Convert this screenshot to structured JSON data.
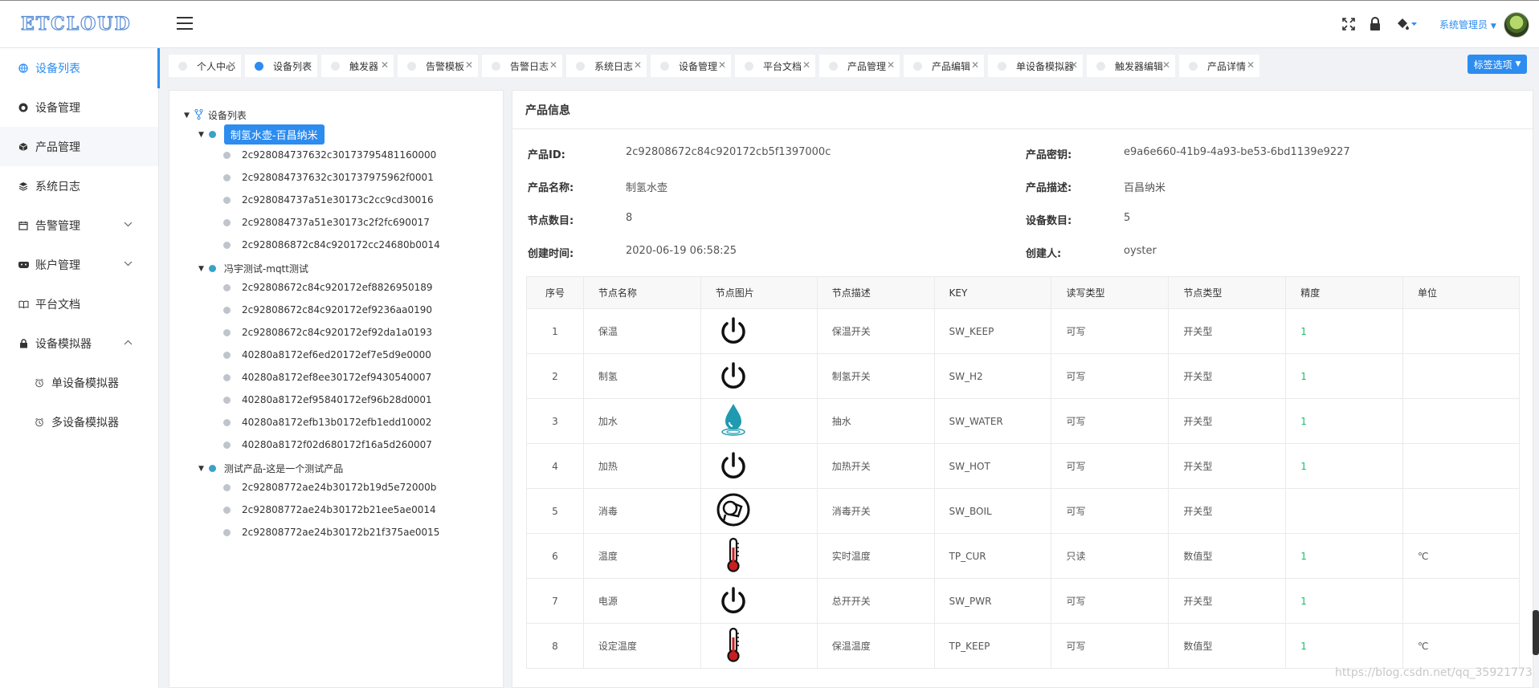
{
  "header": {
    "logo": "ETCLOUD",
    "user_label": "系统管理员",
    "icons": [
      "fullscreen-icon",
      "lock-icon",
      "paint-bucket-icon"
    ]
  },
  "sidebar": {
    "items": [
      {
        "label": "设备列表",
        "icon": "globe-icon",
        "active": true
      },
      {
        "label": "设备管理",
        "icon": "github-icon"
      },
      {
        "label": "产品管理",
        "icon": "cube-icon"
      },
      {
        "label": "系统日志",
        "icon": "layers-icon"
      },
      {
        "label": "告警管理",
        "icon": "calendar-icon",
        "expandable": true
      },
      {
        "label": "账户管理",
        "icon": "gamepad-icon",
        "expandable": true
      },
      {
        "label": "平台文档",
        "icon": "book-icon"
      },
      {
        "label": "设备模拟器",
        "icon": "lock-icon",
        "expandable": true,
        "expanded": true
      }
    ],
    "subitems": [
      {
        "label": "单设备模拟器",
        "icon": "alarm-clock-icon"
      },
      {
        "label": "多设备模拟器",
        "icon": "alarm-clock-icon"
      }
    ]
  },
  "tabs": [
    {
      "label": "个人中心"
    },
    {
      "label": "设备列表",
      "active": true
    },
    {
      "label": "触发器"
    },
    {
      "label": "告警模板"
    },
    {
      "label": "告警日志"
    },
    {
      "label": "系统日志"
    },
    {
      "label": "设备管理"
    },
    {
      "label": "平台文档"
    },
    {
      "label": "产品管理"
    },
    {
      "label": "产品编辑"
    },
    {
      "label": "单设备模拟器"
    },
    {
      "label": "触发器编辑"
    },
    {
      "label": "产品详情"
    }
  ],
  "tab_options_label": "标签选项",
  "tree": {
    "root": "设备列表",
    "groups": [
      {
        "label": "制氢水壶-百昌纳米",
        "selected": true,
        "devices": [
          "2c928084737632c30173795481160000",
          "2c928084737632c301737975962f0001",
          "2c928084737a51e30173c2cc9cd30016",
          "2c928084737a51e30173c2f2fc690017",
          "2c928086872c84c920172cc24680b0014"
        ]
      },
      {
        "label": "冯宇测试-mqtt测试",
        "devices": [
          "2c92808672c84c920172ef8826950189",
          "2c92808672c84c920172ef9236aa0190",
          "2c92808672c84c920172ef92da1a0193",
          "40280a8172ef6ed20172ef7e5d9e0000",
          "40280a8172ef8ee30172ef9430540007",
          "40280a8172ef95840172ef96b28d0001",
          "40280a8172efb13b0172efb1edd10002",
          "40280a8172f02d680172f16a5d260007"
        ]
      },
      {
        "label": "测试产品-这是一个测试产品",
        "devices": [
          "2c92808772ae24b30172b19d5e72000b",
          "2c92808772ae24b30172b21ee5ae0014",
          "2c92808772ae24b30172b21f375ae0015"
        ]
      }
    ]
  },
  "product": {
    "title": "产品信息",
    "fields": {
      "id_label": "产品ID:",
      "id_value": "2c92808672c84c920172cb5f1397000c",
      "secret_label": "产品密钥:",
      "secret_value": "e9a6e660-41b9-4a93-be53-6bd1139e9227",
      "name_label": "产品名称:",
      "name_value": "制氢水壶",
      "desc_label": "产品描述:",
      "desc_value": "百昌纳米",
      "nodes_label": "节点数目:",
      "nodes_value": "8",
      "devices_label": "设备数目:",
      "devices_value": "5",
      "created_label": "创建时间:",
      "created_value": "2020-06-19 06:58:25",
      "creator_label": "创建人:",
      "creator_value": "oyster"
    },
    "columns": [
      "序号",
      "节点名称",
      "节点图片",
      "节点描述",
      "KEY",
      "读写类型",
      "节点类型",
      "精度",
      "单位"
    ],
    "rows": [
      {
        "no": "1",
        "name": "保温",
        "image": "power-icon",
        "desc": "保温开关",
        "key": "SW_KEEP",
        "rw": "可写",
        "type": "开关型",
        "precision": "1",
        "unit": ""
      },
      {
        "no": "2",
        "name": "制氢",
        "image": "power-icon",
        "desc": "制氢开关",
        "key": "SW_H2",
        "rw": "可写",
        "type": "开关型",
        "precision": "1",
        "unit": ""
      },
      {
        "no": "3",
        "name": "加水",
        "image": "water-drop-icon",
        "desc": "抽水",
        "key": "SW_WATER",
        "rw": "可写",
        "type": "开关型",
        "precision": "1",
        "unit": ""
      },
      {
        "no": "4",
        "name": "加热",
        "image": "power-icon",
        "desc": "加热开关",
        "key": "SW_HOT",
        "rw": "可写",
        "type": "开关型",
        "precision": "1",
        "unit": ""
      },
      {
        "no": "5",
        "name": "消毒",
        "image": "disinfect-icon",
        "desc": "消毒开关",
        "key": "SW_BOIL",
        "rw": "可写",
        "type": "开关型",
        "precision": "",
        "unit": ""
      },
      {
        "no": "6",
        "name": "温度",
        "image": "thermometer-icon",
        "desc": "实时温度",
        "key": "TP_CUR",
        "rw": "只读",
        "type": "数值型",
        "precision": "1",
        "unit": "℃"
      },
      {
        "no": "7",
        "name": "电源",
        "image": "power-icon",
        "desc": "总开开关",
        "key": "SW_PWR",
        "rw": "可写",
        "type": "开关型",
        "precision": "1",
        "unit": ""
      },
      {
        "no": "8",
        "name": "设定温度",
        "image": "thermometer-icon",
        "desc": "保温温度",
        "key": "TP_KEEP",
        "rw": "可写",
        "type": "数值型",
        "precision": "1",
        "unit": "℃"
      }
    ]
  },
  "watermark": "https://blog.csdn.net/qq_35921773"
}
